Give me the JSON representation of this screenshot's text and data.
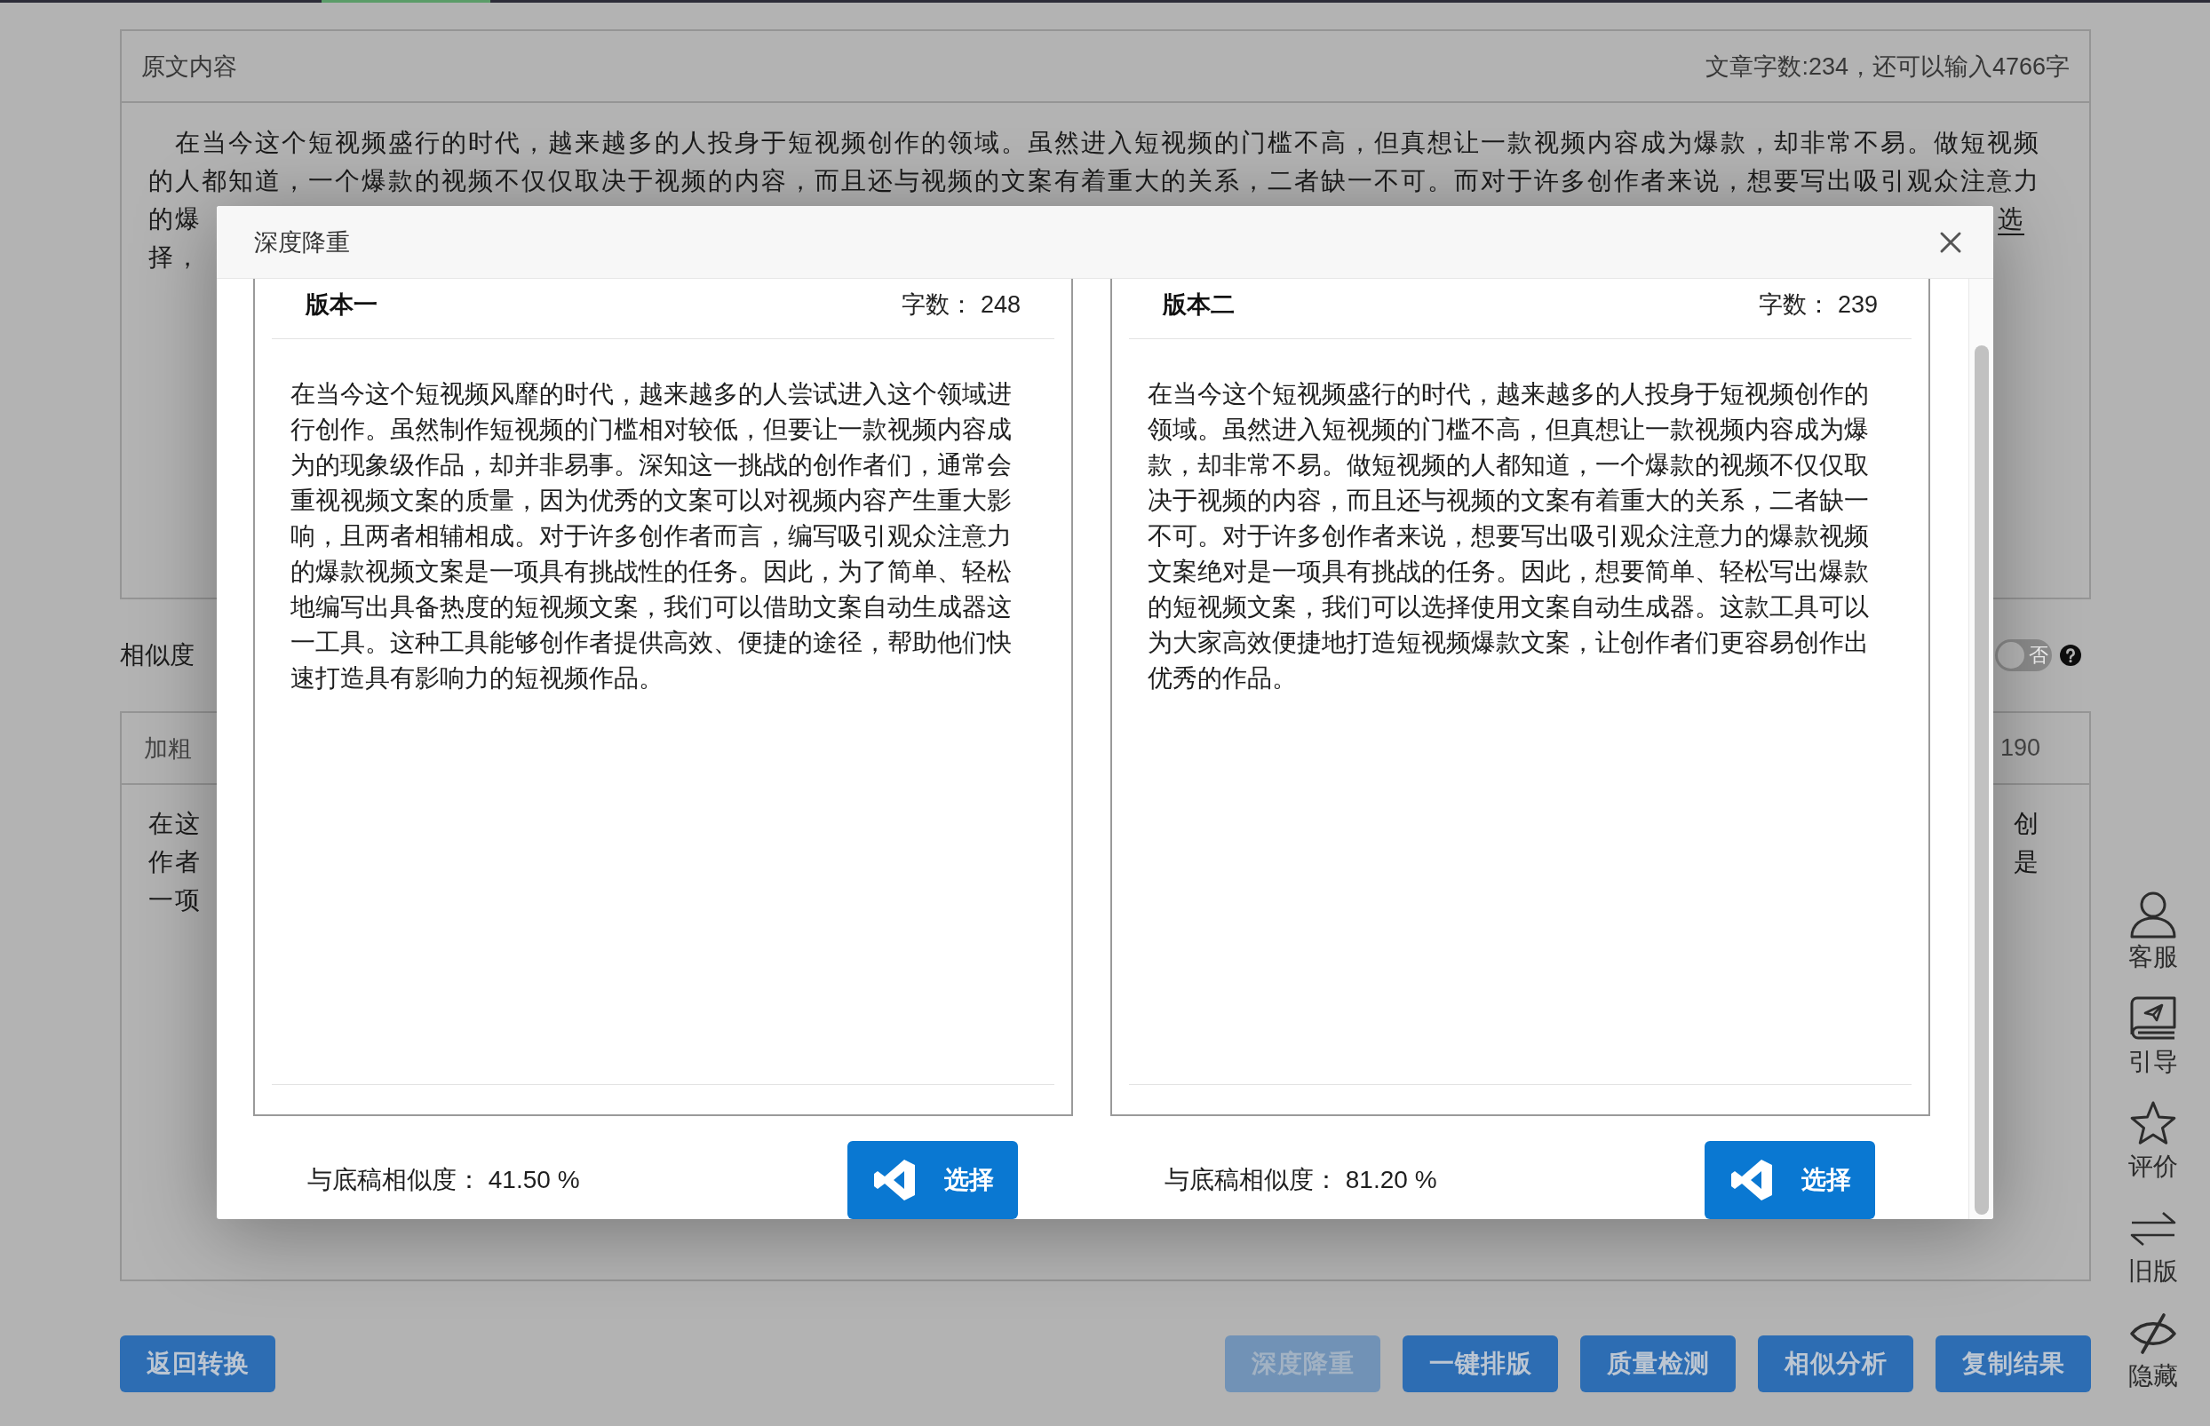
{
  "original_panel": {
    "title": "原文内容",
    "word_count": "文章字数:234，还可以输入4766字",
    "lines": [
      {
        "text": "在当今这个短视频盛行的时代，越来越多的人投身于短视频创作的领域。虽然进入短视频的门槛不高，但真想让一款视频内容成为爆款，却非常不易。做短视频"
      },
      {
        "text": "的人都知道，一个爆款的视频不仅仅取决于视频的内容，而且还与视频的文案有着重大的关系，二者缺一不可。而对于许多创作者来说，想要写出吸引观众注意力"
      },
      {
        "text": "的爆",
        "tail": {
          "text": "选",
          "underlined": true
        }
      },
      {
        "text": "择，"
      }
    ]
  },
  "similarity": {
    "label": "相似度",
    "toggle": {
      "on": false,
      "label": "否"
    }
  },
  "bold_panel": {
    "title": "加粗",
    "count": "190",
    "lines": [
      {
        "text": "在这",
        "tail": {
          "text": "创",
          "underlined": false
        }
      },
      {
        "text": "作者",
        "tail": {
          "text": "是",
          "underlined": false
        }
      },
      {
        "text": "一项"
      }
    ]
  },
  "bottom_buttons": {
    "left": [
      {
        "label": "返回转换",
        "disabled": false
      }
    ],
    "right": [
      {
        "label": "深度降重",
        "disabled": true
      },
      {
        "label": "一键排版",
        "disabled": false
      },
      {
        "label": "质量检测",
        "disabled": false
      },
      {
        "label": "相似分析",
        "disabled": false
      },
      {
        "label": "复制结果",
        "disabled": false
      }
    ]
  },
  "sidebar": [
    {
      "kind": "service",
      "label": "客服"
    },
    {
      "kind": "guide",
      "label": "引导"
    },
    {
      "kind": "rating",
      "label": "评价"
    },
    {
      "kind": "old_version",
      "label": "旧版"
    },
    {
      "kind": "hide",
      "label": "隐藏"
    }
  ],
  "dialog": {
    "title": "深度降重",
    "versions": [
      {
        "title": "版本一",
        "count": "字数： 248",
        "text": "在当今这个短视频风靡的时代，越来越多的人尝试进入这个领域进行创作。虽然制作短视频的门槛相对较低，但要让一款视频内容成为的现象级作品，却并非易事。深知这一挑战的创作者们，通常会重视视频文案的质量，因为优秀的文案可以对视频内容产生重大影响，且两者相辅相成。对于许多创作者而言，编写吸引观众注意力的爆款视频文案是一项具有挑战性的任务。因此，为了简单、轻松地编写出具备热度的短视频文案，我们可以借助文案自动生成器这一工具。这种工具能够创作者提供高效、便捷的途径，帮助他们快速打造具有影响力的短视频作品。",
        "similarity": "与底稿相似度： 41.50 %",
        "button": "选择"
      },
      {
        "title": "版本二",
        "count": "字数： 239",
        "text": "在当今这个短视频盛行的时代，越来越多的人投身于短视频创作的领域。虽然进入短视频的门槛不高，但真想让一款视频内容成为爆款，却非常不易。做短视频的人都知道，一个爆款的视频不仅仅取决于视频的内容，而且还与视频的文案有着重大的关系，二者缺一不可。对于许多创作者来说，想要写出吸引观众注意力的爆款视频文案绝对是一项具有挑战的任务。因此，想要简单、轻松写出爆款的短视频文案，我们可以选择使用文案自动生成器。这款工具可以为大家高效便捷地打造短视频爆款文案，让创作者们更容易创作出优秀的作品。",
        "similarity": "与底稿相似度： 81.20 %",
        "button": "选择"
      }
    ]
  }
}
